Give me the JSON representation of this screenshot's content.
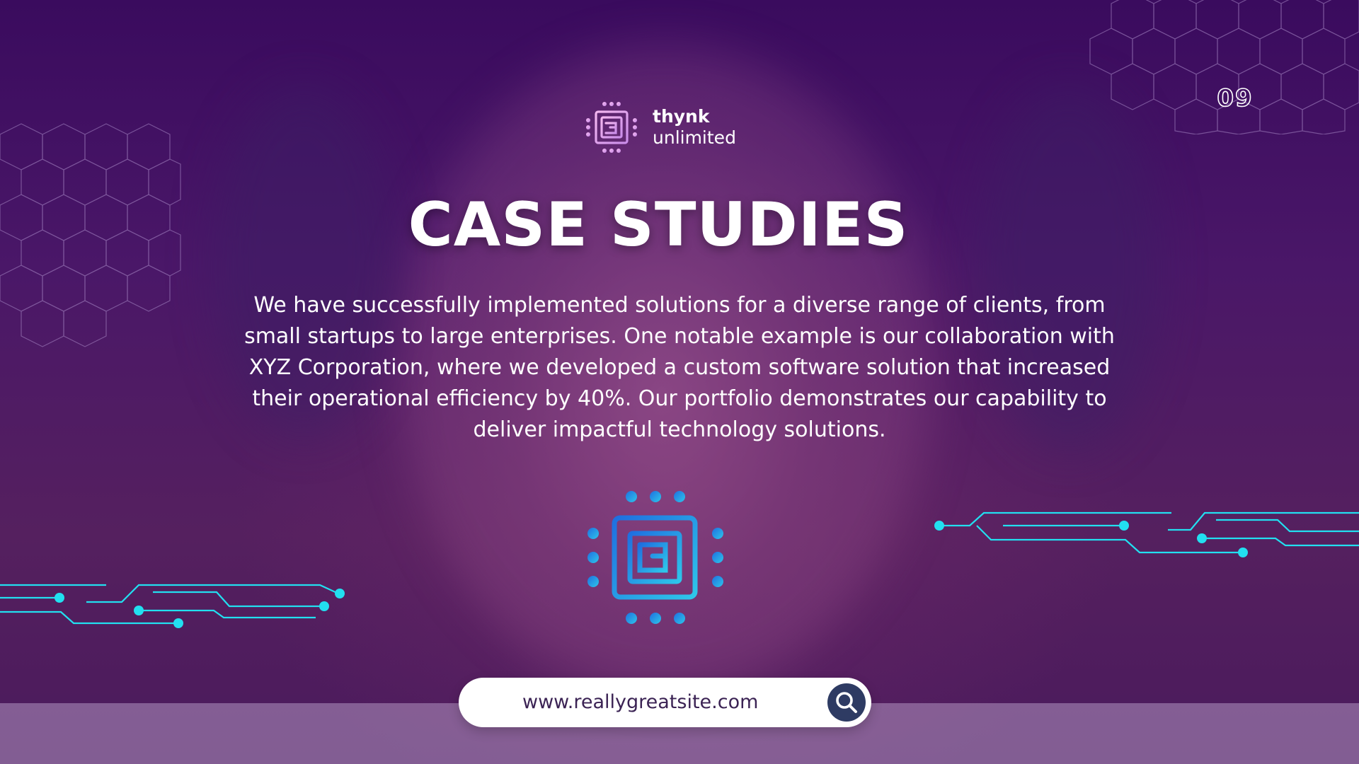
{
  "brand": {
    "name": "thynk",
    "tagline": "unlimited"
  },
  "page_number": "09",
  "title": "CASE STUDIES",
  "body": "We have successfully implemented solutions for a diverse range of clients, from small startups to large enterprises. One notable example is our collaboration with XYZ Corporation, where we developed a custom software solution that increased their operational efficiency by 40%. Our portfolio demonstrates our capability to deliver impactful technology solutions.",
  "website": {
    "url": "www.reallygreatsite.com"
  },
  "icons": {
    "logo": "chip-icon",
    "center": "chip-icon",
    "search": "search-icon"
  },
  "colors": {
    "background": "#4a1768",
    "accent_cyan": "#22e0f0",
    "logo_pink": "#e6a6f0",
    "chip_blue": "#2a8fe6",
    "search_button": "#2e3b63"
  }
}
